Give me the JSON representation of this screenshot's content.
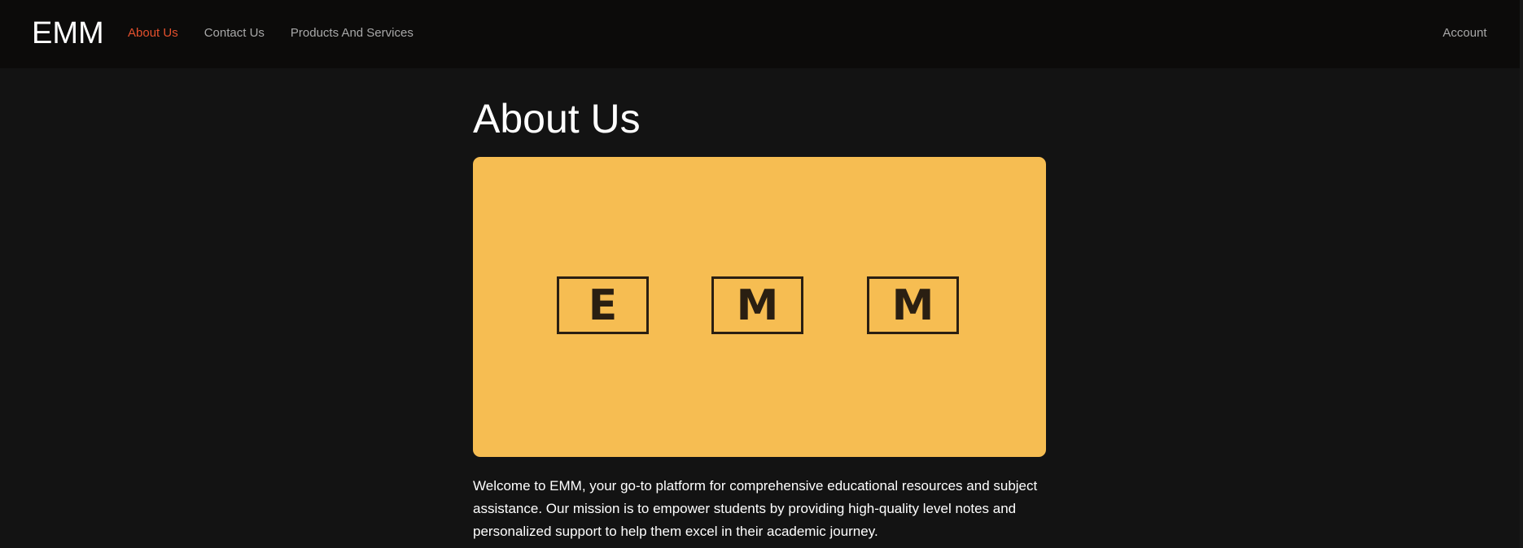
{
  "header": {
    "brand": "EMM",
    "nav": [
      {
        "label": "About Us",
        "active": true
      },
      {
        "label": "Contact Us",
        "active": false
      },
      {
        "label": "Products And Services",
        "active": false
      }
    ],
    "account_label": "Account"
  },
  "main": {
    "title": "About Us",
    "hero": {
      "letters": [
        "E",
        "M",
        "M"
      ]
    },
    "intro": "Welcome to EMM, your go-to platform for comprehensive educational resources and subject assistance. Our mission is to empower students by providing high-quality level notes and personalized support to help them excel in their academic journey."
  },
  "colors": {
    "background": "#131313",
    "header_background": "#0c0b0a",
    "active_link": "#e4502d",
    "nav_link": "#a8a8a8",
    "hero_background": "#f6bd52",
    "logo_ink": "#2a1f12"
  }
}
